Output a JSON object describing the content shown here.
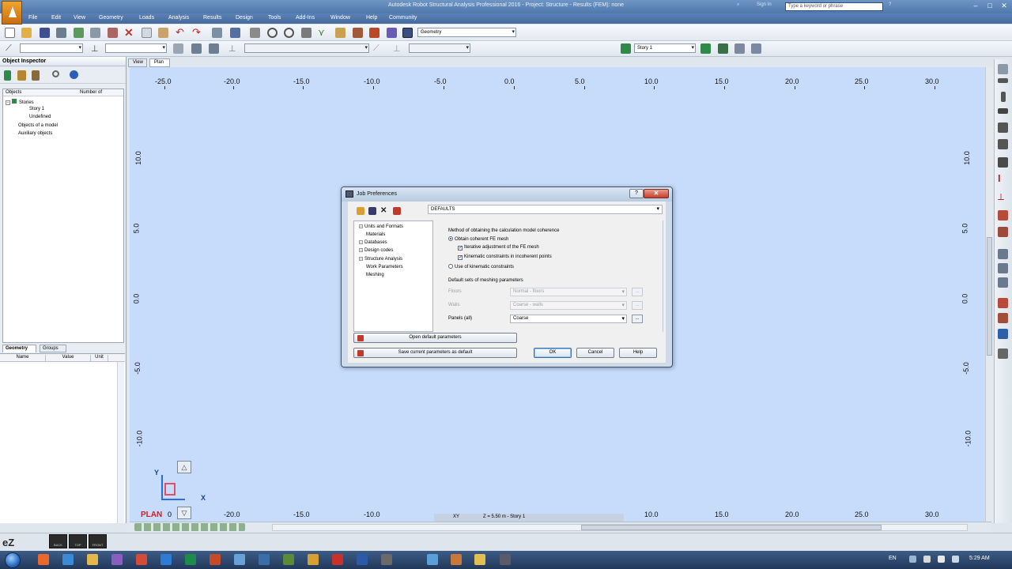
{
  "window": {
    "title": "Autodesk Robot Structural Analysis Professional 2016 - Project: Structure - Results (FEM): none",
    "search_placeholder": "Type a keyword or phrase",
    "sign_in": "Sign In",
    "controls": {
      "minimize": "–",
      "maximize": "□",
      "close": "✕"
    }
  },
  "menu": [
    "File",
    "Edit",
    "View",
    "Geometry",
    "Loads",
    "Analysis",
    "Results",
    "Design",
    "Tools",
    "Add-Ins",
    "Window",
    "Help",
    "Community"
  ],
  "toolbar": {
    "layout_combo": "Geometry",
    "story_combo": "Story 1"
  },
  "inspector": {
    "title": "Object Inspector",
    "columns": {
      "objects": "Objects",
      "number": "Number of"
    },
    "tree": {
      "stories": "Stories",
      "story1": "Story 1",
      "undefined": "Undefined",
      "model_objects": "Objects of a model",
      "auxiliary": "Auxiliary objects"
    },
    "tabs": {
      "geometry": "Geometry",
      "groups": "Groups"
    },
    "grid_columns": {
      "name": "Name",
      "value": "Value",
      "unit": "Unit"
    }
  },
  "view_tabs": {
    "view": "View",
    "plan": "Plan"
  },
  "canvas": {
    "top_axis": [
      "-25.0",
      "-20.0",
      "-15.0",
      "-10.0",
      "-5.0",
      "0.0",
      "5.0",
      "10.0",
      "15.0",
      "20.0",
      "25.0",
      "30.0"
    ],
    "bottom_axis": [
      "-20.0",
      "-15.0",
      "-10.0",
      "10.0",
      "15.0",
      "20.0",
      "25.0",
      "30.0"
    ],
    "left_axis": [
      "10.0",
      "5.0",
      "0.0",
      "-5.0",
      "-10.0"
    ],
    "right_axis": [
      "10.0",
      "5.0",
      "0.0",
      "-5.0",
      "-10.0"
    ],
    "coord_y": "Y",
    "coord_x": "X",
    "plan_label": "PLAN",
    "plan_value": "0",
    "status_xy": "XY",
    "status_level": "Z = 5.50 m - Story 1"
  },
  "statusbar": {
    "logo": "eZ",
    "view_buttons": [
      "BACK",
      "TOP",
      "FRONT"
    ]
  },
  "taskbar": {
    "language": "EN",
    "clock": "5:29 AM"
  },
  "dialog": {
    "title": "Job Preferences",
    "help_glyph": "?",
    "close_glyph": "✕",
    "preset": "DEFAULTS",
    "tree": {
      "units": "Units and Formats",
      "materials": "Materials",
      "databases": "Databases",
      "design_codes": "Design codes",
      "structure_analysis": "Structure Analysis",
      "work_parameters": "Work Parameters",
      "meshing": "Meshing"
    },
    "method_heading": "Method of obtaining the calculation model coherence",
    "obtain_coherent": "Obtain coherent FE mesh",
    "iterative": "Iterative adjustment of the FE mesh",
    "kinematic_incoherent": "Kinematic constraints in incoherent points",
    "use_kinematic": "Use of kinematic constraints",
    "default_sets_heading": "Default sets of meshing parameters",
    "floors_label": "Floors",
    "floors_value": "Normal - floors",
    "walls_label": "Walls",
    "walls_value": "Coarse - walls",
    "panels_label": "Panels (all)",
    "panels_value": "Coarse",
    "ellipsis": "...",
    "open_default": "Open default parameters",
    "save_default": "Save current parameters as default",
    "ok": "OK",
    "cancel": "Cancel",
    "help": "Help"
  }
}
